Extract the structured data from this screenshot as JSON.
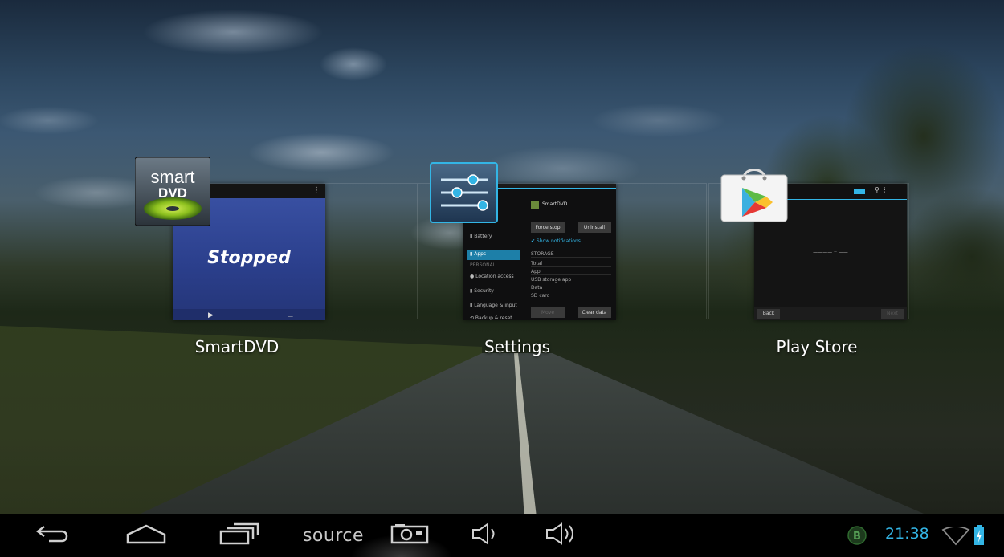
{
  "recents": [
    {
      "app_name": "SmartDVD",
      "icon": "smartdvd-icon",
      "icon_text_top": "smart",
      "icon_text_bottom": "DVD",
      "thumb_text": "Stopped"
    },
    {
      "app_name": "Settings",
      "icon": "settings-sliders-icon"
    },
    {
      "app_name": "Play Store",
      "icon": "play-store-bag-icon"
    }
  ],
  "navbar": {
    "source_label": "source",
    "clock": "21:38",
    "back_icon": "back-arrow-icon",
    "home_icon": "home-icon",
    "recents_icon": "recent-apps-icon",
    "screenshot_icon": "screenshot-icon",
    "vol_down_icon": "volume-down-icon",
    "vol_up_icon": "volume-up-icon",
    "status_icons": [
      "bitcoin-notification-icon",
      "wifi-icon",
      "battery-charging-icon"
    ]
  },
  "colors": {
    "accent": "#33b5e5"
  }
}
